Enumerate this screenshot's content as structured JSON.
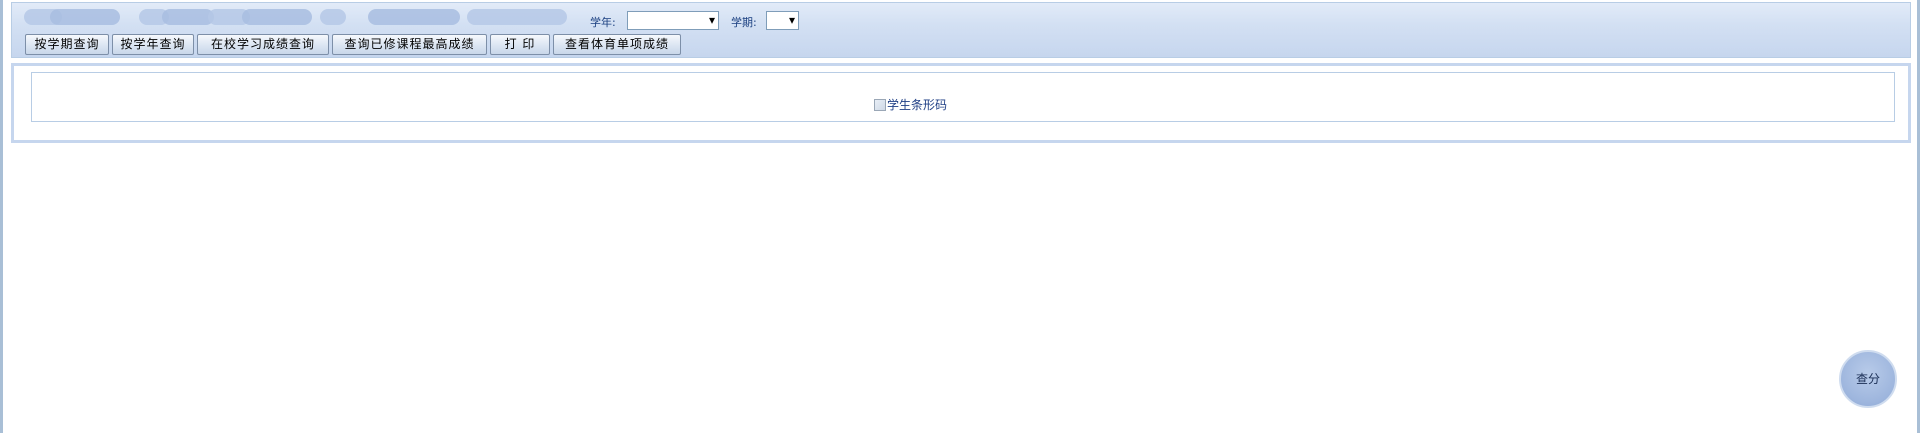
{
  "filters": {
    "year_label": "学年:",
    "year_value": "",
    "term_label": "学期:",
    "term_value": ""
  },
  "buttons": {
    "by_term": "按学期查询",
    "by_year": "按学年查询",
    "in_school": "在校学习成绩查询",
    "highest": "查询已修课程最高成绩",
    "print": "打 印",
    "pe_items": "查看体育单项成绩"
  },
  "content": {
    "barcode_alt": "学生条形码"
  },
  "floating": {
    "score_label": "查分"
  },
  "icons": {
    "barcode": "broken-image-icon",
    "dropdown": "chevron-down-icon"
  },
  "colors": {
    "toolbar_bg": "#d3e0f3",
    "label_text": "#1a3f80",
    "score_button": "#9db5dd"
  }
}
